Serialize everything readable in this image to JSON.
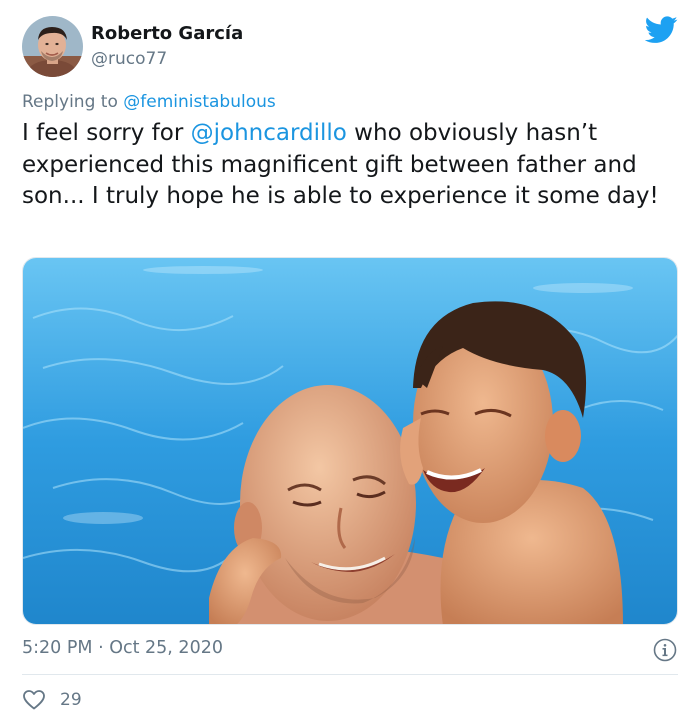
{
  "author": {
    "name": "Roberto García",
    "handle": "@ruco77"
  },
  "reply": {
    "prefix": "Replying to",
    "to": "@feministabulous"
  },
  "tweet": {
    "text_before": "I feel sorry for ",
    "mention": "@johncardillo",
    "text_after": " who obviously hasn’t experienced this magnificent gift between father and son... I truly hope he is able to experience it some day!"
  },
  "meta": {
    "time": "5:20 PM",
    "separator": " · ",
    "date": "Oct 25, 2020"
  },
  "engagement": {
    "likes": "29"
  },
  "icons": {
    "brand": "twitter-bird-icon",
    "info": "info-icon",
    "like": "heart-icon"
  },
  "colors": {
    "link": "#1b95e0",
    "brand": "#1da1f2",
    "muted": "#657786",
    "text": "#14171a",
    "divider": "#e1e8ed"
  }
}
